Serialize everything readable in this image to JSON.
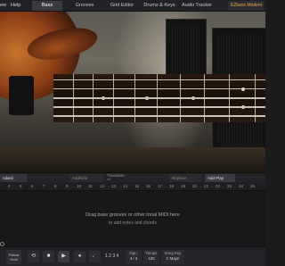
{
  "menu": {
    "items": [
      "ew",
      "Help"
    ]
  },
  "tabs": [
    {
      "label": "Bass",
      "active": true
    },
    {
      "label": "Grooves",
      "active": false
    },
    {
      "label": "Grid Editor",
      "active": false
    },
    {
      "label": "Drums & Keys",
      "active": false
    },
    {
      "label": "Audio Tracker",
      "active": false
    }
  ],
  "preset": {
    "label": "EZbass Modern"
  },
  "colors": {
    "accent": "#e8a23a",
    "background": "#1b1b1d",
    "panel": "#232327"
  },
  "toolbar": {
    "standard_groove": "ndard Groove",
    "add_edit_chords": "Add/Edit Chords",
    "transition_label": "Transition",
    "transition_value": "off",
    "replace_midi": "Replace MIDI...",
    "add_play_style": "Add Play Style"
  },
  "ruler": {
    "bars": [
      "4",
      "5",
      "6",
      "7",
      "8",
      "9",
      "10",
      "11",
      "12",
      "13",
      "14",
      "15",
      "16",
      "17",
      "18",
      "19",
      "20",
      "21",
      "22",
      "23",
      "24",
      "25"
    ]
  },
  "track": {
    "drop_hint": "Drag bass grooves or other tonal MIDI here",
    "drop_sub": "to add notes and chords"
  },
  "transport": {
    "follow_host": "Follow Host",
    "count_in": "1 2 3 4",
    "sign_label": "Sign.",
    "sign_value": "4 / 4",
    "tempo_label": "Tempo",
    "tempo_value": "120",
    "song_key_label": "Song Key",
    "song_key_value": "C Major"
  },
  "icons": [
    "loop-icon",
    "stop-icon",
    "play-icon",
    "record-icon",
    "metronome-icon",
    "help-icon"
  ]
}
